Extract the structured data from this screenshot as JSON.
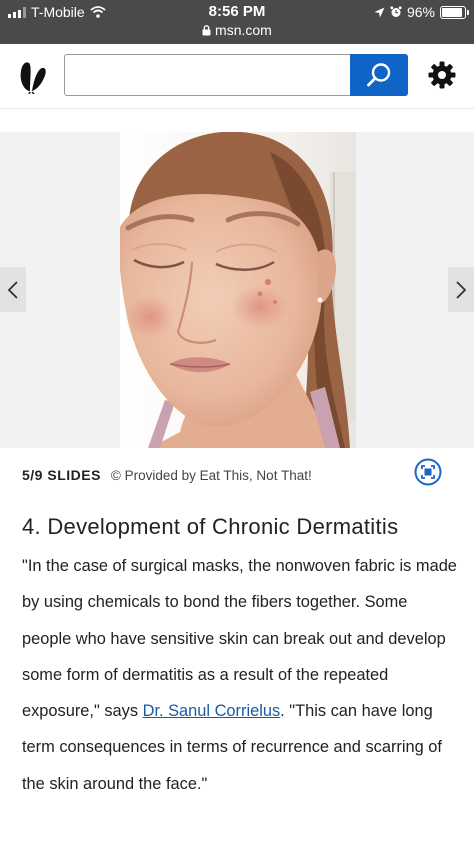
{
  "status_bar": {
    "carrier": "T-Mobile",
    "time": "8:56 PM",
    "url": "msn.com",
    "battery": "96%"
  },
  "header": {
    "search_placeholder": "",
    "icons": [
      "msn-butterfly-logo-icon",
      "search-icon",
      "gear-icon"
    ]
  },
  "slideshow": {
    "counter": "5/9 SLIDES",
    "provider": "© Provided by Eat This, Not That!",
    "icons": [
      "chevron-left-icon",
      "chevron-right-icon",
      "fullscreen-icon"
    ]
  },
  "article": {
    "title": "4. Development of Chronic Dermatitis",
    "para_before_link": "\"In the case of surgical masks, the nonwoven fabric is made by using chemicals to bond the fibers together. Some people who have sensitive skin can break out and develop some form of dermatitis as a result of the repeated exposure,\" says ",
    "link_text": "Dr. Sanul Corrielus",
    "para_after_link": ". \"This can have long term consequences in terms of recurrence and scarring of the skin around the face.\""
  },
  "colors": {
    "status_bar_bg": "#4a4a4a",
    "search_button": "#0f64c5",
    "link": "#1a5aa6",
    "slide_bg": "#f2f2f2"
  }
}
